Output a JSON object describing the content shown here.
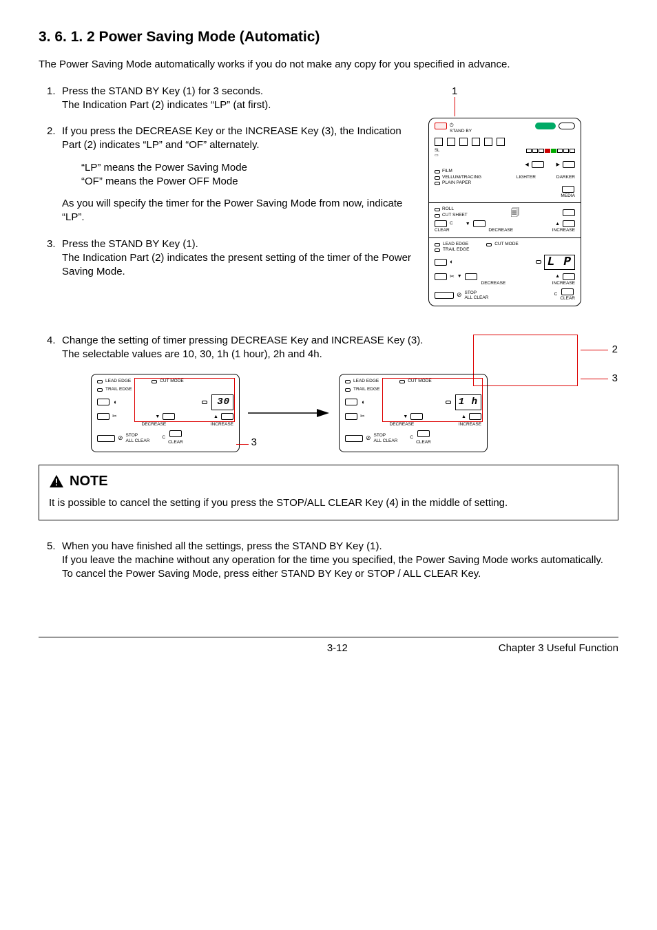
{
  "heading": "3. 6. 1. 2   Power Saving Mode (Automatic)",
  "intro": "The Power Saving Mode automatically works if you do not make any copy for you specified in advance.",
  "steps": {
    "s1": {
      "num": "1.",
      "l1": "Press the STAND BY Key (1) for 3 seconds.",
      "l2": "The Indication Part (2) indicates “LP” (at first)."
    },
    "s2": {
      "num": "2.",
      "l1": "If you press the DECREASE Key or the INCREASE Key (3), the Indication Part (2) indicates “LP” and “OF” alternately.",
      "sub1": "“LP” means the Power Saving Mode",
      "sub2": "“OF” means the Power OFF Mode",
      "l2": "As you will specify the timer for the Power Saving Mode from now, indicate “LP”."
    },
    "s3": {
      "num": "3.",
      "l1": "Press the STAND BY Key (1).",
      "l2": "The Indication Part (2) indicates the present setting of the timer of the Power Saving Mode."
    },
    "s4": {
      "num": "4.",
      "l1": "Change the setting of timer pressing DECREASE Key and INCREASE Key (3).",
      "l2": "The selectable values are 10, 30, 1h (1 hour), 2h and 4h."
    },
    "s5": {
      "num": "5.",
      "l1": "When you have finished all the settings, press the STAND BY Key (1).",
      "l2": "If you leave the machine without any operation for the time you specified, the Power Saving Mode works automatically.",
      "l3": "To cancel the Power Saving Mode, press either STAND BY Key or STOP / ALL CLEAR Key."
    }
  },
  "callouts": {
    "c1": "1",
    "c2": "2",
    "c3": "3",
    "c3b": "3"
  },
  "panel": {
    "standby": "STAND BY",
    "lighter": "LIGHTER",
    "darker": "DARKER",
    "film": "FILM",
    "vellum": "VELLUM/TRACING",
    "plain": "PLAIN PAPER",
    "media": "MEDIA",
    "roll": "ROLL",
    "cutsheet": "CUT SHEET",
    "c": "C",
    "clear": "CLEAR",
    "decrease": "DECREASE",
    "increase": "INCREASE",
    "leadedge": "LEAD EDGE",
    "trailedge": "TRAIL EDGE",
    "cutmode": "CUT MODE",
    "stop": "STOP",
    "allclear": "ALL CLEAR",
    "disp_lp": "L P"
  },
  "mini": {
    "leadedge": "LEAD EDGE",
    "trailedge": "TRAIL EDGE",
    "cutmode": "CUT MODE",
    "decrease": "DECREASE",
    "increase": "INCREASE",
    "stop": "STOP",
    "allclear": "ALL CLEAR",
    "clear": "CLEAR",
    "c": "C",
    "disp30": "30",
    "disp1h": "1 h"
  },
  "note": {
    "title": "NOTE",
    "body": "It is possible to cancel the setting if you press the STOP/ALL CLEAR Key (4) in the middle of setting."
  },
  "footer": {
    "page": "3-12",
    "chapter": "Chapter 3    Useful Function"
  }
}
